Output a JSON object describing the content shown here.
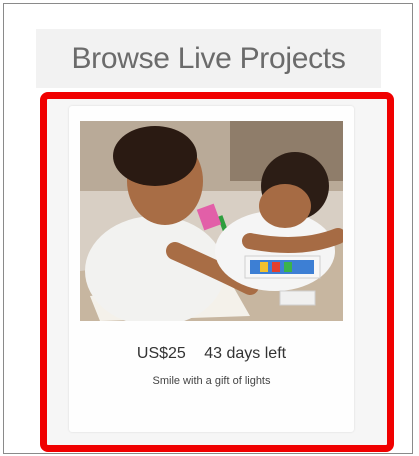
{
  "section": {
    "title": "Browse Live Projects"
  },
  "project_card": {
    "amount": "US$25",
    "days_left": "43 days left",
    "description": "Smile with a gift of lights",
    "image": {
      "subject": "project-photo"
    }
  },
  "colors": {
    "highlight": "#f00000",
    "title_background": "#f2f2f2",
    "title_text": "#6b6b6b"
  }
}
